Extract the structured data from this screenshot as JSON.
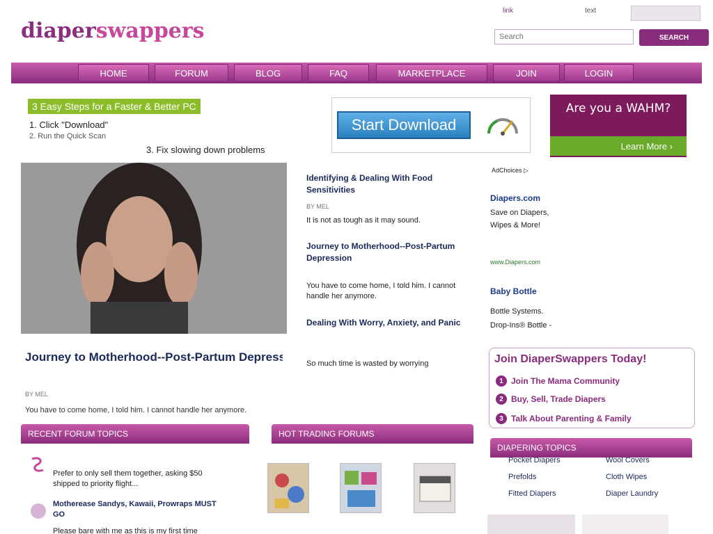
{
  "header": {
    "logo_part1": "diaper",
    "logo_part2": "swappers",
    "top_link": "link",
    "top_text": "text",
    "search_placeholder": "Search",
    "search_button": "SEARCH"
  },
  "nav": {
    "items": [
      {
        "label": "HOME"
      },
      {
        "label": "FORUM"
      },
      {
        "label": "BLOG"
      },
      {
        "label": "FAQ"
      },
      {
        "label": "MARKETPLACE"
      },
      {
        "label": "JOIN"
      },
      {
        "label": "LOGIN"
      }
    ]
  },
  "left_ad": {
    "link1": "3 Easy Steps for a Faster & Better PC",
    "line2": "1. Click \"Download\"",
    "line3": "2. Run the Quick Scan",
    "line4": "3. Fix slowing down problems"
  },
  "iframe_ad": {
    "button": "Start Download"
  },
  "wahm_ad": {
    "question": "Are you a WAHM?",
    "learn_more": "Learn More ›"
  },
  "featured": {
    "title": "Journey to Motherhood--Post-Partum Depression",
    "byline": "BY MEL",
    "text": "You have to come home, I told him. I cannot handle her anymore."
  },
  "articles": [
    {
      "title": "Identifying & Dealing With Food Sensitivities",
      "meta": "BY MEL",
      "text": "It is not as tough as it may sound."
    },
    {
      "title": "Journey to Motherhood--Post-Partum Depression",
      "text": "You have to come home, I told him. I cannot handle her anymore."
    },
    {
      "title": "Dealing With Worry, Anxiety, and Panic",
      "text": "So much time is wasted by worrying"
    }
  ],
  "sidebar_ad": {
    "adchoices": "AdChoices ▷",
    "heading1": "Diapers.com",
    "text1": "Save on Diapers,",
    "text2": "Wipes & More!",
    "url": "www.Diapers.com",
    "heading2": "Baby Bottle",
    "text3": "Bottle Systems.",
    "text4": "Drop-Ins® Bottle -"
  },
  "join": {
    "title": "Join DiaperSwappers Today!",
    "items": [
      {
        "num": "1",
        "label": "Join The Mama Community"
      },
      {
        "num": "2",
        "label": "Buy, Sell, Trade Diapers"
      },
      {
        "num": "3",
        "label": "Talk About Parenting & Family"
      }
    ]
  },
  "sections": {
    "forum": "RECENT FORUM TOPICS",
    "trading": "HOT TRADING FORUMS",
    "diapering": "DIAPERING TOPICS"
  },
  "forum": {
    "excerpt": "Prefer to only sell them together, asking $50 shipped to priority flight...",
    "link": "Motherease Sandys, Kawaii, Prowraps MUST GO",
    "text": "Please bare with me as this is my first time"
  },
  "diapering": {
    "links_left": [
      "Pocket Diapers",
      "Prefolds",
      "Fitted Diapers"
    ],
    "links_right": [
      "Wool Covers",
      "Cloth Wipes",
      "Diaper Laundry"
    ]
  }
}
